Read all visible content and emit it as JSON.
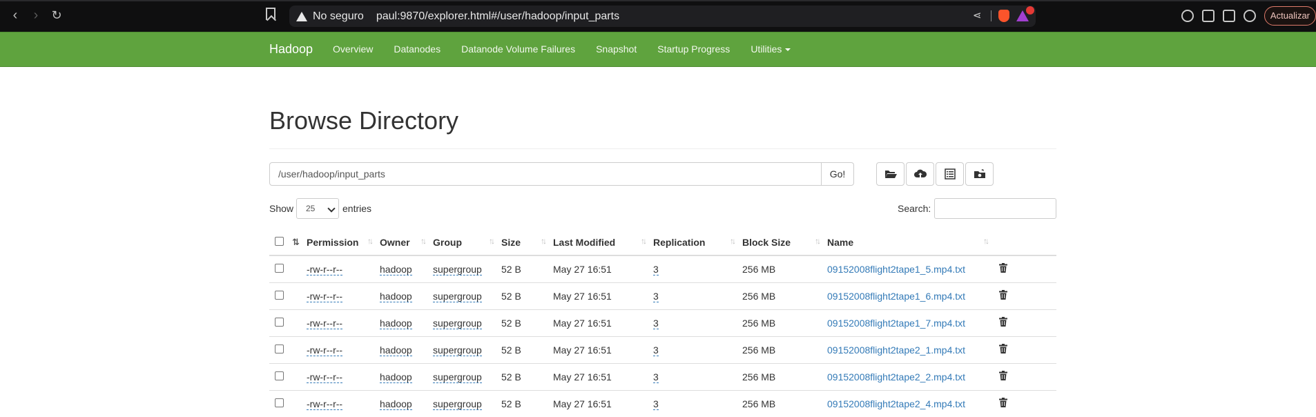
{
  "browser": {
    "security_label": "No seguro",
    "url": "paul:9870/explorer.html#/user/hadoop/input_parts",
    "update_label": "Actualizar"
  },
  "navbar": {
    "brand": "Hadoop",
    "items": [
      {
        "label": "Overview"
      },
      {
        "label": "Datanodes"
      },
      {
        "label": "Datanode Volume Failures"
      },
      {
        "label": "Snapshot"
      },
      {
        "label": "Startup Progress"
      },
      {
        "label": "Utilities"
      }
    ],
    "bg_color": "#5fa33e"
  },
  "page": {
    "title": "Browse Directory",
    "path_value": "/user/hadoop/input_parts",
    "go_label": "Go!",
    "show_label": "Show",
    "entries_value": "25",
    "entries_label": "entries",
    "search_label": "Search:"
  },
  "table": {
    "headers": [
      "Permission",
      "Owner",
      "Group",
      "Size",
      "Last Modified",
      "Replication",
      "Block Size",
      "Name"
    ],
    "rows": [
      {
        "permission": "-rw-r--r--",
        "owner": "hadoop",
        "group": "supergroup",
        "size": "52 B",
        "modified": "May 27 16:51",
        "replication": "3",
        "block_size": "256 MB",
        "name": "09152008flight2tape1_5.mp4.txt"
      },
      {
        "permission": "-rw-r--r--",
        "owner": "hadoop",
        "group": "supergroup",
        "size": "52 B",
        "modified": "May 27 16:51",
        "replication": "3",
        "block_size": "256 MB",
        "name": "09152008flight2tape1_6.mp4.txt"
      },
      {
        "permission": "-rw-r--r--",
        "owner": "hadoop",
        "group": "supergroup",
        "size": "52 B",
        "modified": "May 27 16:51",
        "replication": "3",
        "block_size": "256 MB",
        "name": "09152008flight2tape1_7.mp4.txt"
      },
      {
        "permission": "-rw-r--r--",
        "owner": "hadoop",
        "group": "supergroup",
        "size": "52 B",
        "modified": "May 27 16:51",
        "replication": "3",
        "block_size": "256 MB",
        "name": "09152008flight2tape2_1.mp4.txt"
      },
      {
        "permission": "-rw-r--r--",
        "owner": "hadoop",
        "group": "supergroup",
        "size": "52 B",
        "modified": "May 27 16:51",
        "replication": "3",
        "block_size": "256 MB",
        "name": "09152008flight2tape2_2.mp4.txt"
      },
      {
        "permission": "-rw-r--r--",
        "owner": "hadoop",
        "group": "supergroup",
        "size": "52 B",
        "modified": "May 27 16:51",
        "replication": "3",
        "block_size": "256 MB",
        "name": "09152008flight2tape2_4.mp4.txt"
      }
    ]
  }
}
